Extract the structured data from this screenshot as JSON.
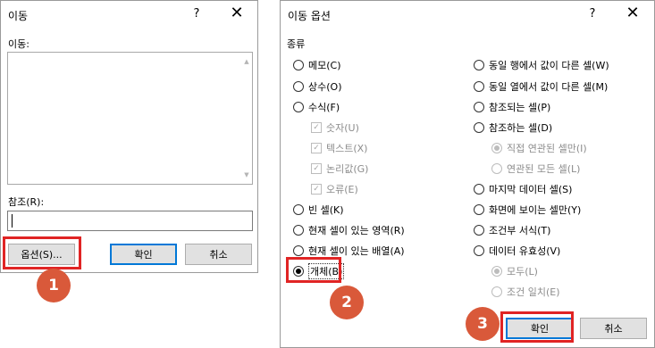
{
  "goto_dialog": {
    "title": "이동",
    "help": "?",
    "close": "✕",
    "goto_label": "이동:",
    "reference_label": "참조(R):",
    "reference_value": "",
    "options_button": "옵션(S)...",
    "ok_button": "확인",
    "cancel_button": "취소"
  },
  "special_dialog": {
    "title": "이동 옵션",
    "help": "?",
    "close": "✕",
    "group_label": "종류",
    "left_options": [
      {
        "label": "메모(C)",
        "type": "radio",
        "checked": false,
        "disabled": false
      },
      {
        "label": "상수(O)",
        "type": "radio",
        "checked": false,
        "disabled": false
      },
      {
        "label": "수식(F)",
        "type": "radio",
        "checked": false,
        "disabled": false
      },
      {
        "label": "숫자(U)",
        "type": "checkbox",
        "checked": true,
        "disabled": true
      },
      {
        "label": "텍스트(X)",
        "type": "checkbox",
        "checked": true,
        "disabled": true
      },
      {
        "label": "논리값(G)",
        "type": "checkbox",
        "checked": true,
        "disabled": true
      },
      {
        "label": "오류(E)",
        "type": "checkbox",
        "checked": true,
        "disabled": true
      },
      {
        "label": "빈 셀(K)",
        "type": "radio",
        "checked": false,
        "disabled": false
      },
      {
        "label": "현재 셀이 있는 영역(R)",
        "type": "radio",
        "checked": false,
        "disabled": false
      },
      {
        "label": "현재 셀이 있는 배열(A)",
        "type": "radio",
        "checked": false,
        "disabled": false
      },
      {
        "label": "개체(B)",
        "type": "radio",
        "checked": true,
        "disabled": false
      }
    ],
    "right_options": [
      {
        "label": "동일 행에서 값이 다른 셀(W)",
        "type": "radio",
        "checked": false,
        "disabled": false
      },
      {
        "label": "동일 열에서 값이 다른 셀(M)",
        "type": "radio",
        "checked": false,
        "disabled": false
      },
      {
        "label": "참조되는 셀(P)",
        "type": "radio",
        "checked": false,
        "disabled": false
      },
      {
        "label": "참조하는 셀(D)",
        "type": "radio",
        "checked": false,
        "disabled": false
      },
      {
        "label": "직접 연관된 셀만(I)",
        "type": "radio",
        "checked": true,
        "disabled": true
      },
      {
        "label": "연관된 모든 셀(L)",
        "type": "radio",
        "checked": false,
        "disabled": true
      },
      {
        "label": "마지막 데이터 셀(S)",
        "type": "radio",
        "checked": false,
        "disabled": false
      },
      {
        "label": "화면에 보이는 셀만(Y)",
        "type": "radio",
        "checked": false,
        "disabled": false
      },
      {
        "label": "조건부 서식(T)",
        "type": "radio",
        "checked": false,
        "disabled": false
      },
      {
        "label": "데이터 유효성(V)",
        "type": "radio",
        "checked": false,
        "disabled": false
      },
      {
        "label": "모두(L)",
        "type": "radio",
        "checked": true,
        "disabled": true
      },
      {
        "label": "조건 일치(E)",
        "type": "radio",
        "checked": false,
        "disabled": true
      }
    ],
    "ok_button": "확인",
    "cancel_button": "취소"
  },
  "steps": [
    "1",
    "2",
    "3"
  ],
  "colors": {
    "highlight": "#e02424",
    "step_badge": "#d9593a",
    "default_button_border": "#0078d7",
    "disabled_text": "#8c8c8c"
  }
}
